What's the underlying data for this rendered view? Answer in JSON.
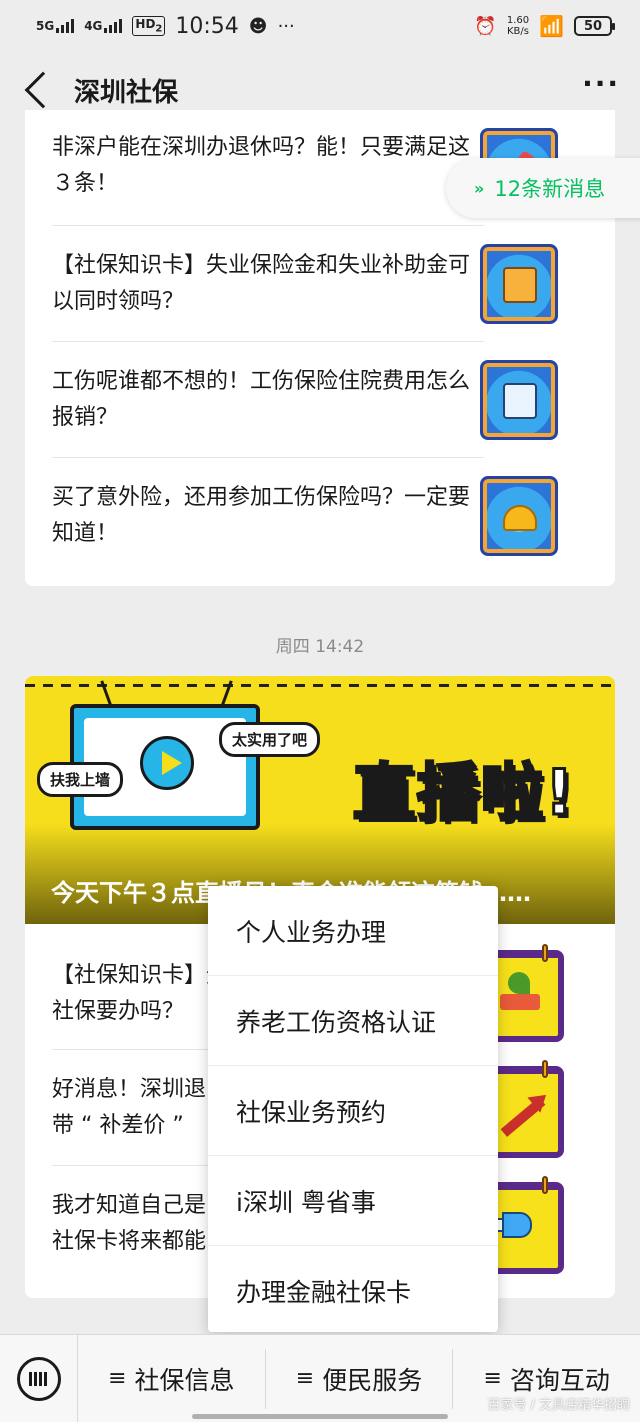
{
  "status_bar": {
    "signal1": "5G",
    "signal2": "4G",
    "hd": "HD",
    "hd_sub": "2",
    "time": "10:54",
    "net_speed_value": "1.60",
    "net_speed_unit": "KB/s",
    "battery": "50"
  },
  "nav": {
    "title": "深圳社保",
    "back_icon": "chevron-left-icon",
    "more_icon": "more-dots-icon",
    "more": "···"
  },
  "new_messages": {
    "label": "12条新消息",
    "icon": "double-chevron-up-icon"
  },
  "card1": {
    "articles": [
      {
        "title": "非深户能在深圳办退休吗？能！只要满足这３条！",
        "thumb_icon": "pen-icon"
      },
      {
        "title": "【社保知识卡】失业保险金和失业补助金可以同时领吗？",
        "thumb_icon": "book-icon"
      },
      {
        "title": "工伤呢谁都不想的！工伤保险住院费用怎么报销？",
        "thumb_icon": "form-icon"
      },
      {
        "title": "买了意外险，还用参加工伤保险吗？一定要知道！",
        "thumb_icon": "hardhat-icon"
      }
    ]
  },
  "timestamp": "周四 14:42",
  "card2": {
    "banner": {
      "tag_left": "扶我上墙",
      "tag_right": "太实用了吧",
      "big_text": "直播啦!",
      "caption": "今天下午３点直播见！真金准能领这笔钱……"
    },
    "articles": [
      {
        "title": "【社保知识卡】无……社保要办吗？",
        "title_line1": "【社保知识卡】无",
        "title_line2": "社保要办吗？",
        "thumb_icon": "plant-book-icon"
      },
      {
        "title": "好消息！深圳……带“补差价”",
        "title_line1": "好消息！深圳退",
        "title_line2": "带 “ 补差价 ”",
        "thumb_icon": "arrow-up-icon"
      },
      {
        "title": "我才知道自己是……社保卡将来都能",
        "title_line1": "我才知道自己是",
        "title_line2": "社保卡将来都能",
        "thumb_icon": "megaphone-icon"
      }
    ]
  },
  "popup_menu": {
    "items": [
      "个人业务办理",
      "养老工伤资格认证",
      "社保业务预约",
      "i深圳 粤省事",
      "办理金融社保卡"
    ]
  },
  "bottom_bar": {
    "keyboard_icon": "keyboard-icon",
    "tabs": [
      {
        "icon": "≡",
        "label": "社保信息"
      },
      {
        "icon": "≡",
        "label": "便民服务"
      },
      {
        "icon": "≡",
        "label": "咨询互动"
      }
    ]
  },
  "watermark": "百家号 / 文具店精华招聘",
  "colors": {
    "accent_green": "#07c160",
    "banner_yellow": "#f6de1c",
    "thumb_blue": "#2d74d8",
    "thumb_purple": "#5a2a8a"
  }
}
